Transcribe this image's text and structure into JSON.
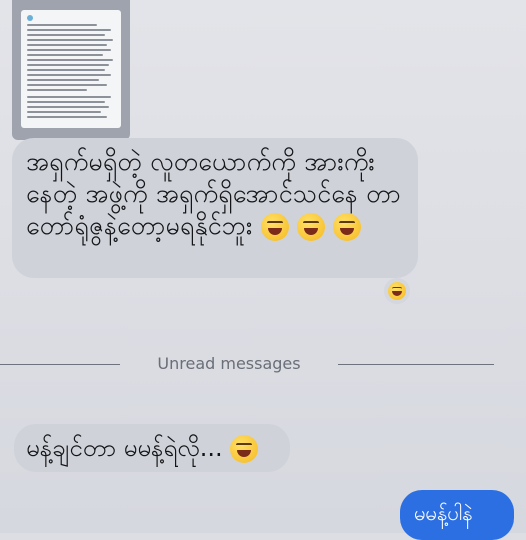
{
  "chat": {
    "attachment": {
      "icon": "screenshot-thumbnail"
    },
    "message_1": {
      "text": "အရှက်မရှိတဲ့ လူတယောက်ကို အားကိုး နေတဲ့ အဖွဲ့ကို အရှက်ရှိအောင်သင်နေ တာ တော်ရုံဇွနဲ့တော့မရနိုင်ဘူး",
      "emoji": "laughing-face-icon",
      "reaction": "laughing-face-icon"
    },
    "divider_label": "Unread messages",
    "message_2": {
      "text": "မန့်ချင်တာ မမန့်ရဲလို...",
      "emoji": "laughing-face-icon"
    },
    "outgoing": {
      "text": "မမန့်ပါနဲ"
    }
  },
  "colors": {
    "incoming_bubble": "#cfd2d9",
    "outgoing_bubble": "#2b6fe2",
    "background": "#dcdee4"
  }
}
